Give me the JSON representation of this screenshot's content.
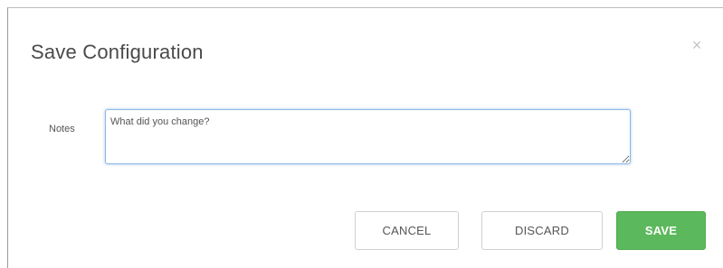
{
  "dialog": {
    "title": "Save Configuration",
    "close_glyph": "×",
    "close_icon": "close-icon"
  },
  "notes": {
    "label": "Notes",
    "placeholder": "What did you change?",
    "value": ""
  },
  "buttons": {
    "cancel": "CANCEL",
    "discard": "DISCARD",
    "save": "SAVE"
  },
  "colors": {
    "primary": "#5cb85c",
    "focus_border": "#8fb8e3"
  }
}
